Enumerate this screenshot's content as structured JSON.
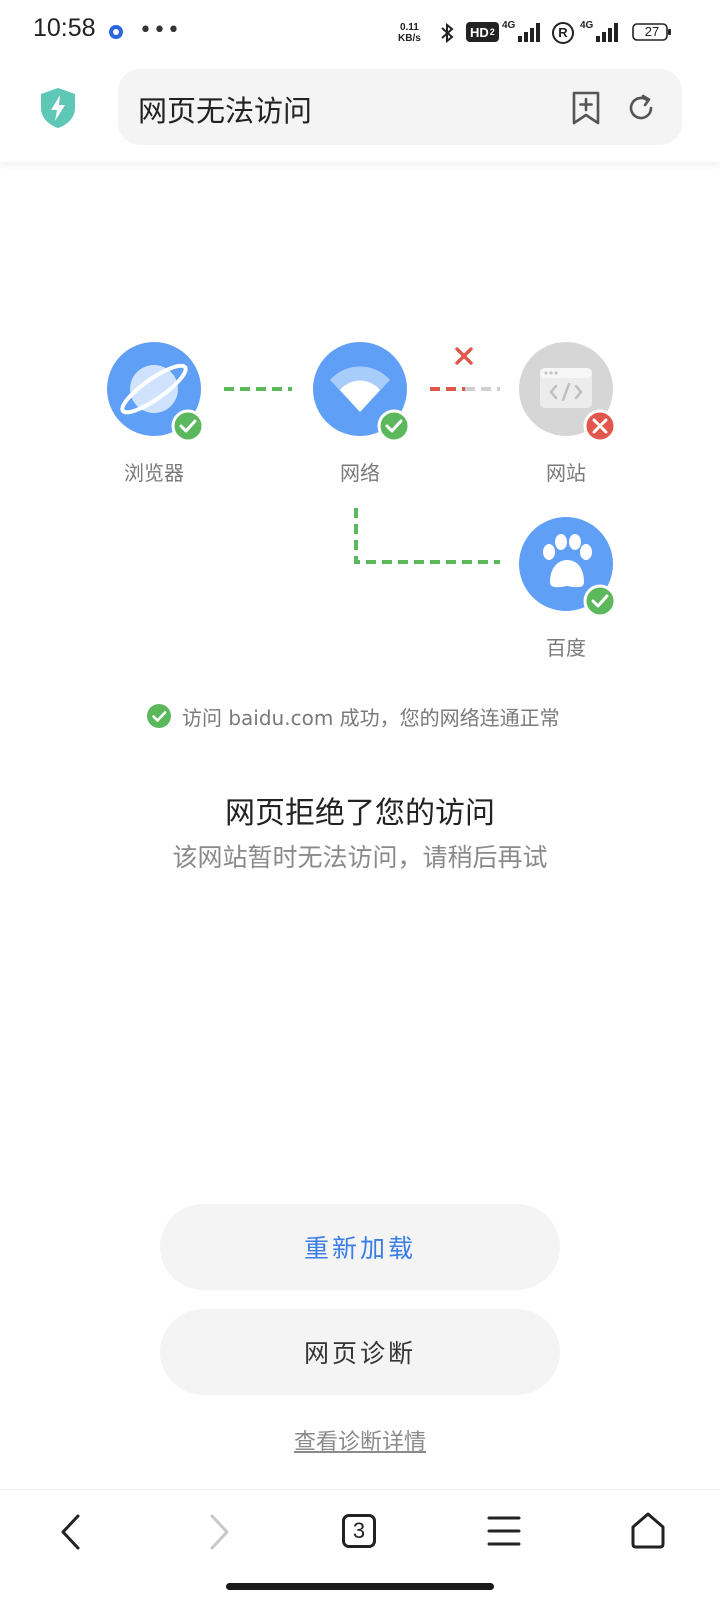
{
  "status_bar": {
    "time": "10:58",
    "net_speed_value": "0.11",
    "net_speed_unit": "KB/s",
    "hd_badge": "HD",
    "hd_sub": "2",
    "sig1_label": "4G",
    "sig2_label": "4G",
    "registered_mark": "R",
    "battery": "27"
  },
  "top_bar": {
    "title": "网页无法访问",
    "icons": [
      "shield-bolt-icon",
      "add-bookmark-icon",
      "refresh-icon"
    ]
  },
  "diagram": {
    "nodes": [
      {
        "label": "浏览器",
        "icon": "planet-icon",
        "status": "ok"
      },
      {
        "label": "网络",
        "icon": "wifi-icon",
        "status": "ok"
      },
      {
        "label": "网站",
        "icon": "code-window-icon",
        "status": "error"
      },
      {
        "label": "百度",
        "icon": "paw-icon",
        "status": "ok"
      }
    ],
    "colors": {
      "ok": "#5cb85c",
      "error": "#e2574c",
      "node_blue": "#5f9ff5",
      "node_gray": "#d6d6d6"
    }
  },
  "message": "访问 baidu.com 成功，您的网络连通正常",
  "error": {
    "title": "网页拒绝了您的访问",
    "subtitle": "该网站暂时无法访问，请稍后再试"
  },
  "buttons": {
    "reload": "重新加载",
    "diagnose": "网页诊断",
    "details_link": "查看诊断详情"
  },
  "bottom_nav": {
    "tab_count": "3",
    "items": [
      "back-icon",
      "forward-icon",
      "tabs-icon",
      "menu-icon",
      "home-icon"
    ]
  },
  "accent_color": "#3a7ee6"
}
